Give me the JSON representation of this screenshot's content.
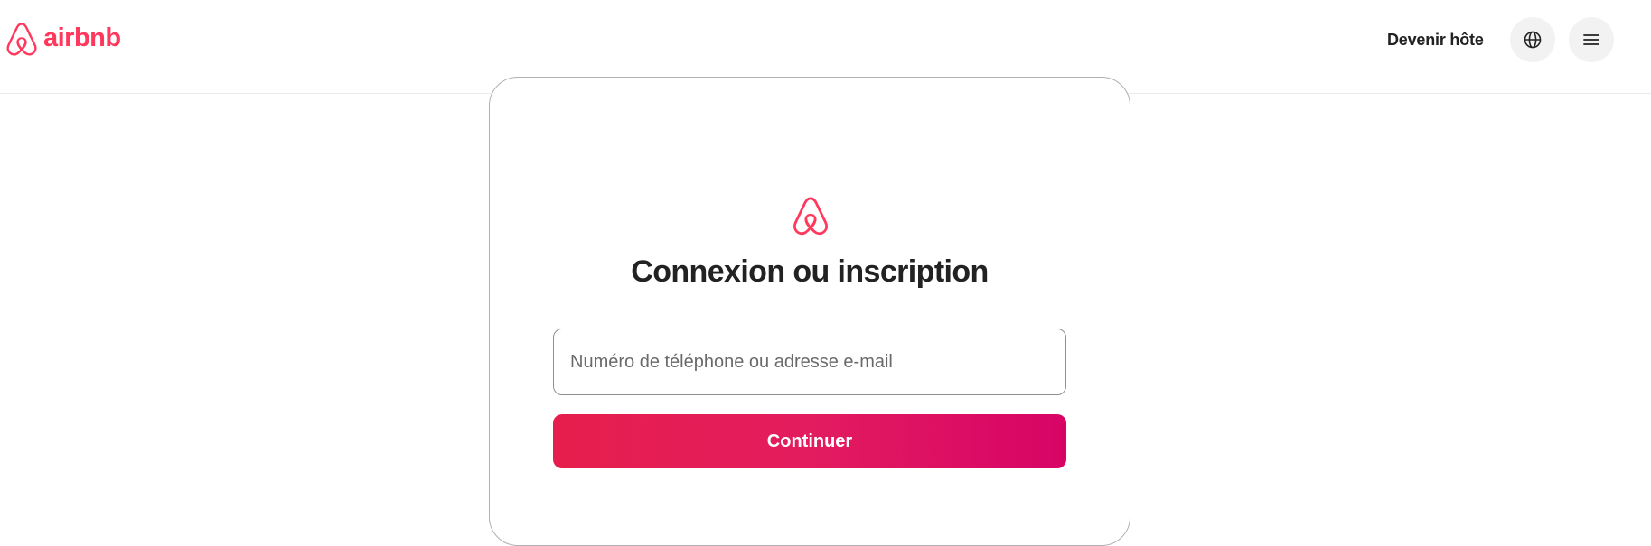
{
  "header": {
    "logo_text": "airbnb",
    "host_link": "Devenir hôte",
    "globe_icon": "globe-icon",
    "menu_icon": "hamburger-menu-icon"
  },
  "login": {
    "title": "Connexion ou inscription",
    "input_placeholder": "Numéro de téléphone ou adresse e-mail",
    "input_value": "",
    "continue_label": "Continuer"
  },
  "colors": {
    "brand": "#ff385c",
    "button_gradient_start": "#e61e4d",
    "button_gradient_end": "#d70466",
    "text": "#222222"
  }
}
